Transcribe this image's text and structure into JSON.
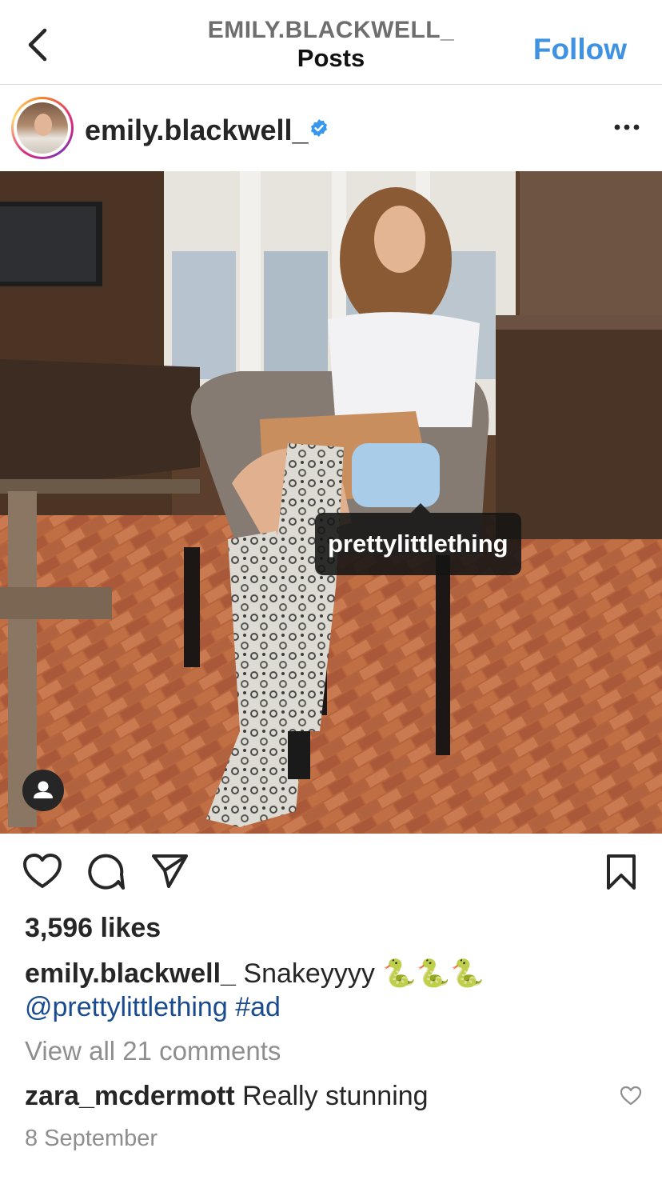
{
  "header": {
    "username": "EMILY.BLACKWELL_",
    "subtitle": "Posts",
    "follow_label": "Follow",
    "back_icon": "chevron-left-icon"
  },
  "post": {
    "author": "emily.blackwell_",
    "verified": true,
    "more_icon": "more-horizontal-icon",
    "product_tag": "prettylittlething",
    "likes": "3,596 likes",
    "caption_user": "emily.blackwell_",
    "caption_text": "Snakeyyyy 🐍🐍🐍",
    "mention": "@prettylittlething",
    "hashtag": "#ad",
    "view_comments": "View all 21 comments",
    "top_comment": {
      "user": "zara_mcdermott",
      "text": "Really stunning"
    },
    "date": "8 September"
  },
  "colors": {
    "accent": "#3f91e2",
    "link": "#1a4b8f",
    "muted": "#8e8e8e",
    "verified": "#3897f0"
  }
}
